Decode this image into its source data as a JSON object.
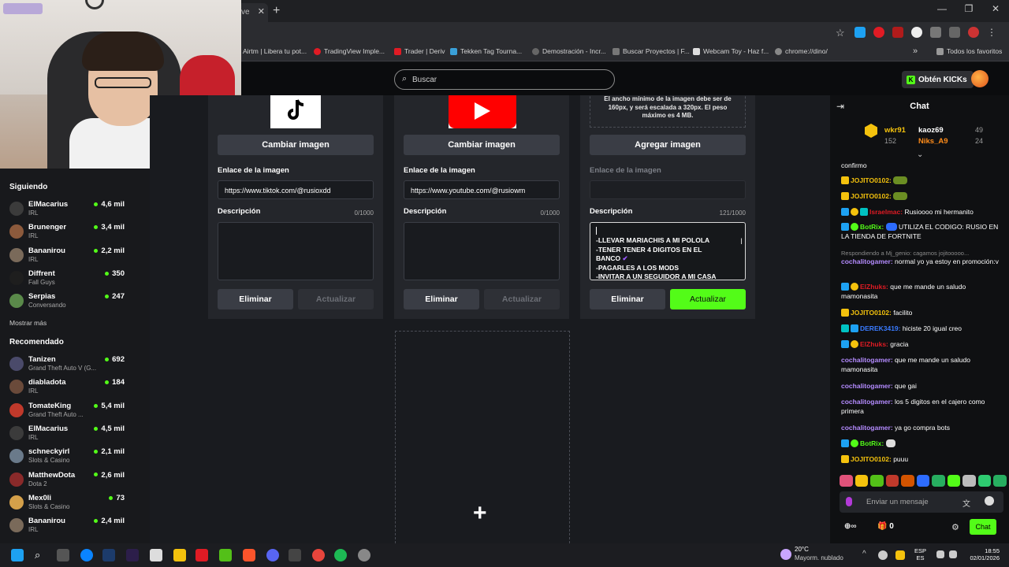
{
  "browser": {
    "tab_fragment": "ve",
    "bookmarks": [
      {
        "label": "Airtm | Libera tu pot...",
        "color": "#444"
      },
      {
        "label": "TradingView Imple...",
        "color": "#e01b24"
      },
      {
        "label": "Trader | Deriv",
        "color": "#e01b24"
      },
      {
        "label": "Tekken Tag Tourna...",
        "color": "#3aa0d8"
      },
      {
        "label": "Demostración - Incr...",
        "color": "#666"
      },
      {
        "label": "Buscar Proyectos | F...",
        "color": "#777"
      },
      {
        "label": "Webcam Toy - Haz f...",
        "color": "#ddd"
      },
      {
        "label": "chrome://dino/",
        "color": "#888"
      }
    ],
    "bookmarks_folder": "Todos los favoritos"
  },
  "header": {
    "search_placeholder": "Buscar",
    "kicks_button": "Obtén KICKs",
    "brand_color": "#53fc18"
  },
  "sidebar": {
    "following_title": "Siguiendo",
    "following": [
      {
        "name": "ElMacarius",
        "category": "IRL",
        "viewers": "4,6 mil",
        "color": "#3b3b3b"
      },
      {
        "name": "Brunenger",
        "category": "IRL",
        "viewers": "3,4 mil",
        "color": "#8c5a3c"
      },
      {
        "name": "Bananirou",
        "category": "IRL",
        "viewers": "2,2 mil",
        "color": "#7a6a5a"
      },
      {
        "name": "Diffrent",
        "category": "Fall Guys",
        "viewers": "350",
        "color": "#1e1e1e"
      },
      {
        "name": "Serpias",
        "category": "Conversando",
        "viewers": "247",
        "color": "#5a8a4a"
      }
    ],
    "show_more": "Mostrar más",
    "recommended_title": "Recomendado",
    "recommended": [
      {
        "name": "Tanizen",
        "category": "Grand Theft Auto V (G...",
        "viewers": "692",
        "color": "#4a4a6a"
      },
      {
        "name": "diabladota",
        "category": "IRL",
        "viewers": "184",
        "color": "#6a4a3a"
      },
      {
        "name": "TomateKing",
        "category": "Grand Theft Auto ...",
        "viewers": "5,4 mil",
        "color": "#c0392b"
      },
      {
        "name": "ElMacarius",
        "category": "IRL",
        "viewers": "4,5 mil",
        "color": "#3b3b3b"
      },
      {
        "name": "schneckyirl",
        "category": "Slots & Casino",
        "viewers": "2,1 mil",
        "color": "#6a7a8a"
      },
      {
        "name": "MatthewDota",
        "category": "Dota 2",
        "viewers": "2,6 mil",
        "color": "#8a2a2a"
      },
      {
        "name": "Mex0li",
        "category": "Slots & Casino",
        "viewers": "73",
        "color": "#d4a04a"
      },
      {
        "name": "Bananirou",
        "category": "IRL",
        "viewers": "2,4 mil",
        "color": "#7a6a5a"
      }
    ]
  },
  "panels": {
    "change_image": "Cambiar imagen",
    "add_image": "Agregar imagen",
    "image_link_label": "Enlace de la imagen",
    "description_label": "Descripción",
    "delete_label": "Eliminar",
    "update_label": "Actualizar",
    "upload_note": "El ancho mínimo de la imagen debe ser de 160px, y será escalada a 320px. El peso máximo es 4 MB.",
    "items": [
      {
        "link": "https://www.tiktok.com/@rusioxdd",
        "counter": "0/1000"
      },
      {
        "link": "https://www.youtube.com/@rusiowm",
        "counter": "0/1000"
      },
      {
        "link": "",
        "counter": "121/1000",
        "description_lines": [
          "-LLEVAR MARIACHIS A MI POLOLA",
          "-TENER TENER 4 DIGITOS EN EL",
          "BANCO",
          "-PAGARLES A LOS MODS",
          "-INVITAR A UN SEGUIDOR A MI CASA"
        ]
      }
    ]
  },
  "chat": {
    "title": "Chat",
    "leaderboard": [
      {
        "name": "wkr91",
        "points": "152",
        "color": "#f4c20d"
      },
      {
        "name": "kaoz69",
        "points": "49",
        "color": "#fff"
      },
      {
        "name": "Niks_A9",
        "points": "24",
        "color": "#ff8c1a"
      }
    ],
    "messages": [
      {
        "user": "",
        "text": "confirmo",
        "color": "#fff"
      },
      {
        "user": "JOJITO0102:",
        "text": "",
        "color": "#f4c20d"
      },
      {
        "user": "JOJITO0102:",
        "text": "",
        "color": "#f4c20d"
      },
      {
        "user": "Israelmac:",
        "text": "Rusioooo mi hermanito",
        "color": "#e01b24"
      },
      {
        "user": "BotRix:",
        "text": "UTILIZA EL CODIGO: RUSIO EN LA TIENDA DE FORTNITE",
        "color": "#53fc18"
      },
      {
        "user": "",
        "text": "Respondiendo a Mj_genio: cagamos jojitooooo...",
        "color": "#8a8a8a"
      },
      {
        "user": "cochalitogamer:",
        "text": "normal yo ya estoy en promoción:v",
        "color": "#b48bff"
      },
      {
        "user": "ElZhuks:",
        "text": "que me mande un saludo mamonasita",
        "color": "#e01b24"
      },
      {
        "user": "JOJITO0102:",
        "text": "facilito",
        "color": "#f4c20d"
      },
      {
        "user": "DEREK3419:",
        "text": "hiciste 20 igual creo",
        "color": "#3a7bff"
      },
      {
        "user": "ElZhuks:",
        "text": "gracia",
        "color": "#e01b24"
      },
      {
        "user": "cochalitogamer:",
        "text": "que me mande un saludo mamonasita",
        "color": "#b48bff"
      },
      {
        "user": "cochalitogamer:",
        "text": "que gai",
        "color": "#b48bff"
      },
      {
        "user": "cochalitogamer:",
        "text": "los 5 digitos en el cajero como primera",
        "color": "#b48bff"
      },
      {
        "user": "cochalitogamer:",
        "text": "ya go compra bots",
        "color": "#b48bff"
      },
      {
        "user": "BotRix:",
        "text": "",
        "color": "#53fc18"
      },
      {
        "user": "JOJITO0102:",
        "text": "puuu",
        "color": "#f4c20d"
      }
    ],
    "input_placeholder": "Enviar un mensaje",
    "gift_count": "0",
    "send_label": "Chat"
  },
  "taskbar": {
    "weather_temp": "20°C",
    "weather_desc": "Mayorm. nublado",
    "lang_top": "ESP",
    "lang_bottom": "ES",
    "time": "18:55",
    "date": "02/01/2026"
  }
}
